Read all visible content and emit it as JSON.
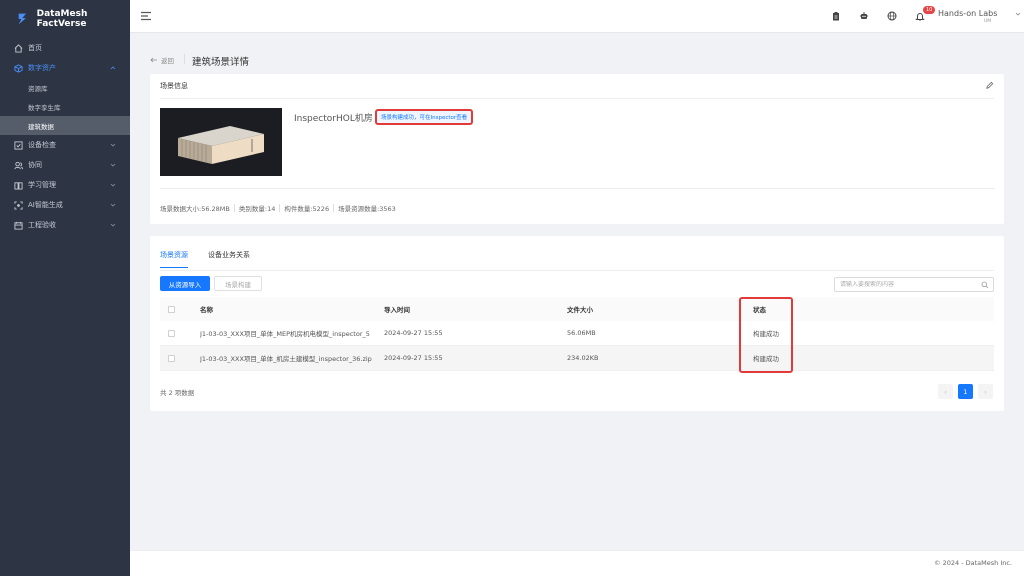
{
  "brand": {
    "name": "DataMesh FactVerse"
  },
  "sidebar": {
    "items": [
      {
        "label": "首页",
        "icon": "home-icon"
      },
      {
        "label": "数字资产",
        "icon": "cube-icon"
      },
      {
        "label": "设备检查",
        "icon": "check-square-icon"
      },
      {
        "label": "协同",
        "icon": "users-icon"
      },
      {
        "label": "学习管理",
        "icon": "book-icon"
      },
      {
        "label": "AI智能生成",
        "icon": "ai-icon"
      },
      {
        "label": "工程验收",
        "icon": "calendar-icon"
      }
    ],
    "subitems": [
      "资源库",
      "数字孪生库",
      "建筑数据"
    ]
  },
  "header": {
    "notification_count": "10",
    "user_name": "Hands-on Labs",
    "user_sub": "UM"
  },
  "breadcrumb": {
    "back": "返回",
    "title": "建筑场景详情"
  },
  "scene_info": {
    "section_title": "场景信息",
    "name": "InspectorHOL机房",
    "tag": "场景构建成功，可在Inspector查看",
    "stats": [
      "场景数据大小:56.28MB",
      "类别数量:14",
      "构件数量:5226",
      "场景资源数量:3563"
    ]
  },
  "resources": {
    "tabs": [
      "场景资源",
      "设备业务关系"
    ],
    "import_button": "从资源导入",
    "build_button": "场景构建",
    "search_placeholder": "请输入要搜索的内容",
    "columns": [
      "名称",
      "导入时间",
      "文件大小",
      "状态"
    ],
    "rows": [
      {
        "name": "J1-03-03_XXX项目_单体_MEP机房机电模型_inspector_5",
        "time": "2024-09-27 15:55",
        "size": "56.06MB",
        "status": "构建成功"
      },
      {
        "name": "J1-03-03_XXX项目_单体_机房土建模型_inspector_36.zip",
        "time": "2024-09-27 15:55",
        "size": "234.02KB",
        "status": "构建成功"
      }
    ],
    "total": "共 2 项数据",
    "pagination": {
      "prev": "‹",
      "current": "1",
      "next": "›"
    }
  },
  "footer": {
    "text": "© 2024 - DataMesh Inc."
  },
  "colors": {
    "primary": "#1677ff",
    "sidebar_bg": "#2d3444",
    "highlight": "#e23a3a"
  }
}
